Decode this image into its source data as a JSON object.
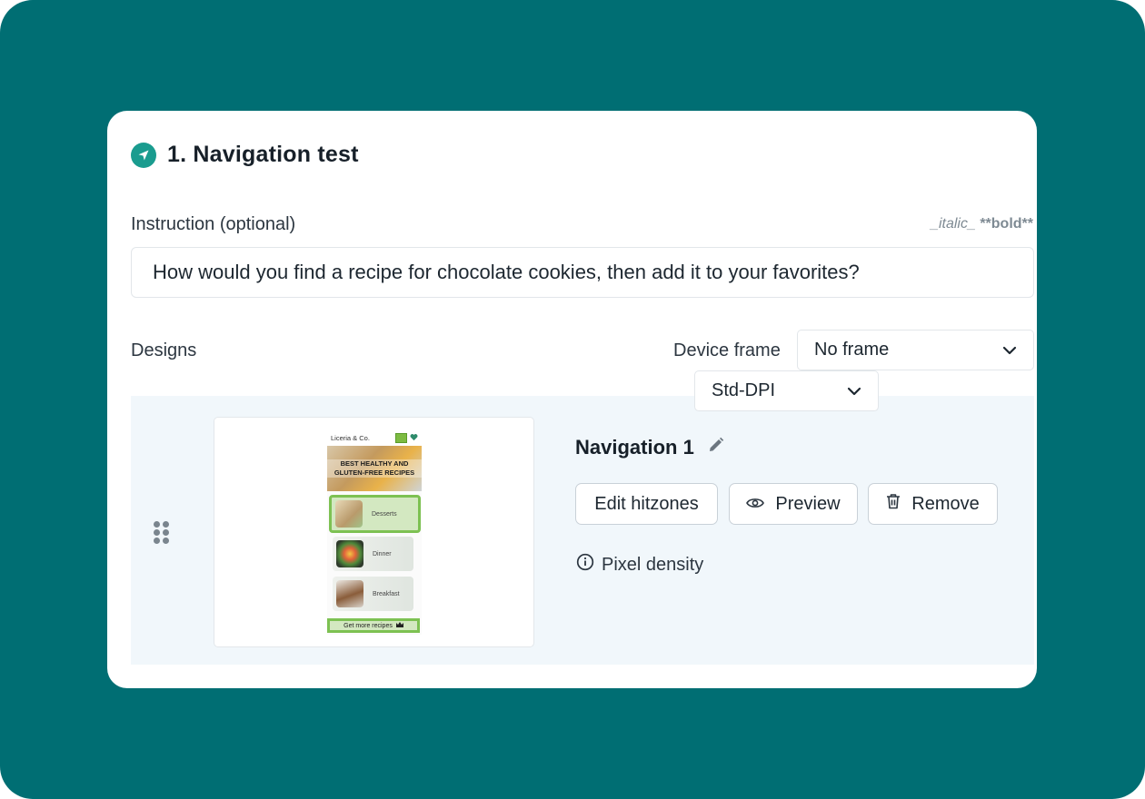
{
  "test": {
    "title": "1. Navigation test",
    "icon": "navigation-arrow-icon"
  },
  "instruction": {
    "label": "Instruction (optional)",
    "format_hint_italic": "_italic_",
    "format_hint_bold": "**bold**",
    "value": "How would you find a recipe for chocolate cookies, then add it to your favorites?"
  },
  "designs": {
    "label": "Designs",
    "device_frame_label": "Device frame",
    "device_frame_value": "No frame"
  },
  "design_item": {
    "name": "Navigation 1",
    "edit_hitzones_label": "Edit hitzones",
    "preview_label": "Preview",
    "remove_label": "Remove",
    "pixel_density_label": "Pixel density",
    "pixel_density_value": "Std-DPI",
    "thumbnail": {
      "brand": "Liceria & Co.",
      "hero_text": "BEST HEALTHY AND GLUTEN-FREE RECIPES",
      "categories": [
        "Desserts",
        "Dinner",
        "Breakfast"
      ],
      "cta": "Get more recipes"
    }
  },
  "colors": {
    "background": "#006e73",
    "accent": "#1a9c8f",
    "hitzone": "#7dc152"
  }
}
